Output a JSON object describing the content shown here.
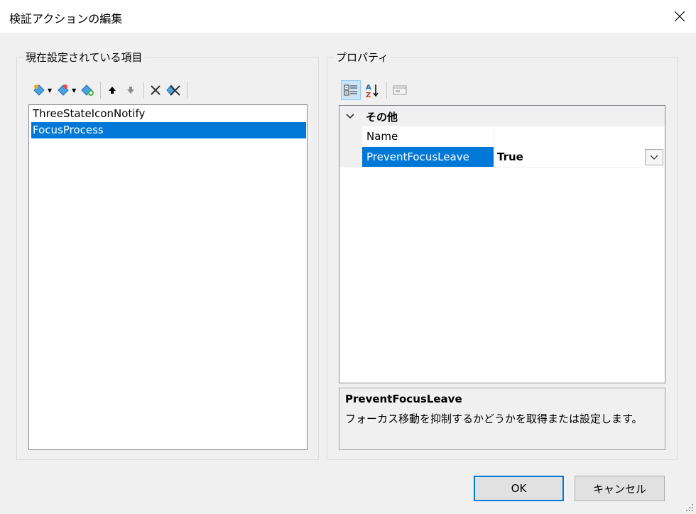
{
  "window": {
    "title": "検証アクションの編集"
  },
  "left_panel": {
    "group_title": "現在設定されている項目",
    "toolbar": {
      "add_icon": "add-action-icon",
      "add_dropdown_icon": "add-action-dropdown-icon",
      "insert_icon": "insert-action-icon",
      "move_up_icon": "arrow-up-icon",
      "move_down_icon": "arrow-down-icon",
      "delete_icon": "delete-icon",
      "delete_all_icon": "delete-all-icon"
    },
    "items": [
      {
        "label": "ThreeStateIconNotify",
        "selected": false
      },
      {
        "label": "FocusProcess",
        "selected": true
      }
    ]
  },
  "right_panel": {
    "group_title": "プロパティ",
    "toolbar": {
      "categorized_icon": "categorized-icon",
      "alphabetical_icon": "alphabetical-sort-icon",
      "property_pages_icon": "property-pages-icon"
    },
    "category": {
      "name": "その他"
    },
    "properties": [
      {
        "name": "Name",
        "value": ""
      },
      {
        "name": "PreventFocusLeave",
        "value": "True"
      }
    ],
    "description": {
      "title": "PreventFocusLeave",
      "text": "フォーカス移動を抑制するかどうかを取得または設定します。"
    }
  },
  "buttons": {
    "ok": "OK",
    "cancel": "キャンセル"
  },
  "colors": {
    "selection": "#0078d7",
    "background": "#f0f0f0"
  }
}
